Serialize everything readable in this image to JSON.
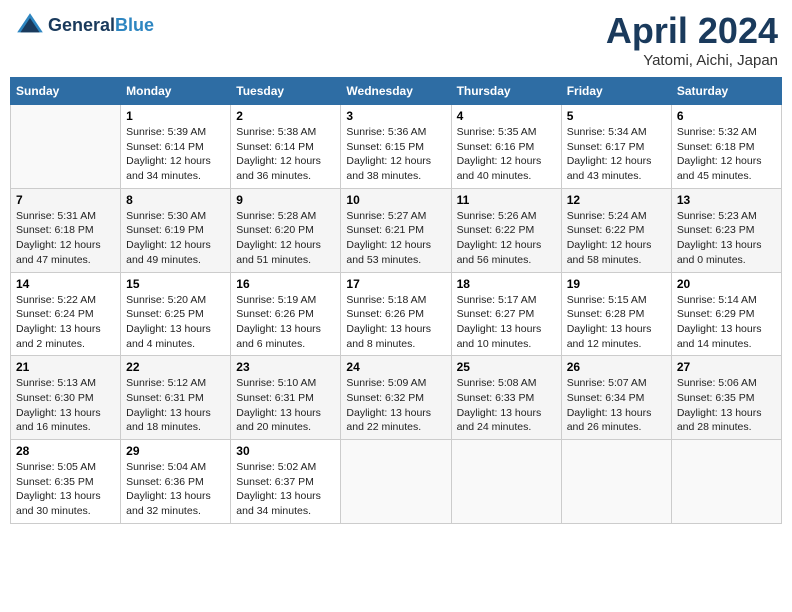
{
  "header": {
    "logo_line1": "General",
    "logo_line2": "Blue",
    "month_title": "April 2024",
    "location": "Yatomi, Aichi, Japan"
  },
  "weekdays": [
    "Sunday",
    "Monday",
    "Tuesday",
    "Wednesday",
    "Thursday",
    "Friday",
    "Saturday"
  ],
  "weeks": [
    [
      {
        "day": "",
        "info": ""
      },
      {
        "day": "1",
        "info": "Sunrise: 5:39 AM\nSunset: 6:14 PM\nDaylight: 12 hours\nand 34 minutes."
      },
      {
        "day": "2",
        "info": "Sunrise: 5:38 AM\nSunset: 6:14 PM\nDaylight: 12 hours\nand 36 minutes."
      },
      {
        "day": "3",
        "info": "Sunrise: 5:36 AM\nSunset: 6:15 PM\nDaylight: 12 hours\nand 38 minutes."
      },
      {
        "day": "4",
        "info": "Sunrise: 5:35 AM\nSunset: 6:16 PM\nDaylight: 12 hours\nand 40 minutes."
      },
      {
        "day": "5",
        "info": "Sunrise: 5:34 AM\nSunset: 6:17 PM\nDaylight: 12 hours\nand 43 minutes."
      },
      {
        "day": "6",
        "info": "Sunrise: 5:32 AM\nSunset: 6:18 PM\nDaylight: 12 hours\nand 45 minutes."
      }
    ],
    [
      {
        "day": "7",
        "info": "Sunrise: 5:31 AM\nSunset: 6:18 PM\nDaylight: 12 hours\nand 47 minutes."
      },
      {
        "day": "8",
        "info": "Sunrise: 5:30 AM\nSunset: 6:19 PM\nDaylight: 12 hours\nand 49 minutes."
      },
      {
        "day": "9",
        "info": "Sunrise: 5:28 AM\nSunset: 6:20 PM\nDaylight: 12 hours\nand 51 minutes."
      },
      {
        "day": "10",
        "info": "Sunrise: 5:27 AM\nSunset: 6:21 PM\nDaylight: 12 hours\nand 53 minutes."
      },
      {
        "day": "11",
        "info": "Sunrise: 5:26 AM\nSunset: 6:22 PM\nDaylight: 12 hours\nand 56 minutes."
      },
      {
        "day": "12",
        "info": "Sunrise: 5:24 AM\nSunset: 6:22 PM\nDaylight: 12 hours\nand 58 minutes."
      },
      {
        "day": "13",
        "info": "Sunrise: 5:23 AM\nSunset: 6:23 PM\nDaylight: 13 hours\nand 0 minutes."
      }
    ],
    [
      {
        "day": "14",
        "info": "Sunrise: 5:22 AM\nSunset: 6:24 PM\nDaylight: 13 hours\nand 2 minutes."
      },
      {
        "day": "15",
        "info": "Sunrise: 5:20 AM\nSunset: 6:25 PM\nDaylight: 13 hours\nand 4 minutes."
      },
      {
        "day": "16",
        "info": "Sunrise: 5:19 AM\nSunset: 6:26 PM\nDaylight: 13 hours\nand 6 minutes."
      },
      {
        "day": "17",
        "info": "Sunrise: 5:18 AM\nSunset: 6:26 PM\nDaylight: 13 hours\nand 8 minutes."
      },
      {
        "day": "18",
        "info": "Sunrise: 5:17 AM\nSunset: 6:27 PM\nDaylight: 13 hours\nand 10 minutes."
      },
      {
        "day": "19",
        "info": "Sunrise: 5:15 AM\nSunset: 6:28 PM\nDaylight: 13 hours\nand 12 minutes."
      },
      {
        "day": "20",
        "info": "Sunrise: 5:14 AM\nSunset: 6:29 PM\nDaylight: 13 hours\nand 14 minutes."
      }
    ],
    [
      {
        "day": "21",
        "info": "Sunrise: 5:13 AM\nSunset: 6:30 PM\nDaylight: 13 hours\nand 16 minutes."
      },
      {
        "day": "22",
        "info": "Sunrise: 5:12 AM\nSunset: 6:31 PM\nDaylight: 13 hours\nand 18 minutes."
      },
      {
        "day": "23",
        "info": "Sunrise: 5:10 AM\nSunset: 6:31 PM\nDaylight: 13 hours\nand 20 minutes."
      },
      {
        "day": "24",
        "info": "Sunrise: 5:09 AM\nSunset: 6:32 PM\nDaylight: 13 hours\nand 22 minutes."
      },
      {
        "day": "25",
        "info": "Sunrise: 5:08 AM\nSunset: 6:33 PM\nDaylight: 13 hours\nand 24 minutes."
      },
      {
        "day": "26",
        "info": "Sunrise: 5:07 AM\nSunset: 6:34 PM\nDaylight: 13 hours\nand 26 minutes."
      },
      {
        "day": "27",
        "info": "Sunrise: 5:06 AM\nSunset: 6:35 PM\nDaylight: 13 hours\nand 28 minutes."
      }
    ],
    [
      {
        "day": "28",
        "info": "Sunrise: 5:05 AM\nSunset: 6:35 PM\nDaylight: 13 hours\nand 30 minutes."
      },
      {
        "day": "29",
        "info": "Sunrise: 5:04 AM\nSunset: 6:36 PM\nDaylight: 13 hours\nand 32 minutes."
      },
      {
        "day": "30",
        "info": "Sunrise: 5:02 AM\nSunset: 6:37 PM\nDaylight: 13 hours\nand 34 minutes."
      },
      {
        "day": "",
        "info": ""
      },
      {
        "day": "",
        "info": ""
      },
      {
        "day": "",
        "info": ""
      },
      {
        "day": "",
        "info": ""
      }
    ]
  ]
}
